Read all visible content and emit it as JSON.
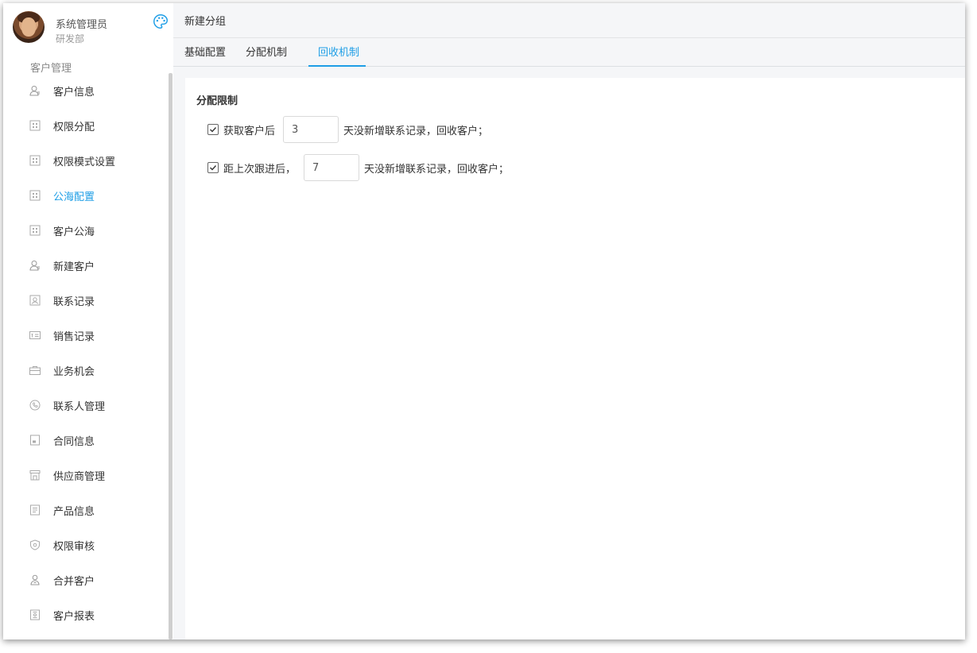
{
  "user": {
    "name": "系统管理员",
    "department": "研发部"
  },
  "sidebar": {
    "section_title": "客户管理",
    "active_color": "#1e9ee6",
    "items": [
      {
        "label": "客户信息",
        "icon": "user-icon"
      },
      {
        "label": "权限分配",
        "icon": "grid-icon"
      },
      {
        "label": "权限模式设置",
        "icon": "grid-icon"
      },
      {
        "label": "公海配置",
        "icon": "grid-icon",
        "active": true
      },
      {
        "label": "客户公海",
        "icon": "grid-icon"
      },
      {
        "label": "新建客户",
        "icon": "user-icon"
      },
      {
        "label": "联系记录",
        "icon": "record-icon"
      },
      {
        "label": "销售记录",
        "icon": "card-icon"
      },
      {
        "label": "业务机会",
        "icon": "briefcase-icon"
      },
      {
        "label": "联系人管理",
        "icon": "phone-icon"
      },
      {
        "label": "合同信息",
        "icon": "contract-icon"
      },
      {
        "label": "供应商管理",
        "icon": "store-icon"
      },
      {
        "label": "产品信息",
        "icon": "document-icon"
      },
      {
        "label": "权限审核",
        "icon": "shield-icon"
      },
      {
        "label": "合并客户",
        "icon": "merge-user-icon"
      },
      {
        "label": "客户报表",
        "icon": "report-icon"
      }
    ]
  },
  "header": {
    "title": "新建分组"
  },
  "tabs": [
    {
      "label": "基础配置"
    },
    {
      "label": "分配机制"
    },
    {
      "label": "回收机制",
      "active": true
    }
  ],
  "content": {
    "section_title": "分配限制",
    "rules": [
      {
        "checked": true,
        "label": "获取客户后",
        "value": "3",
        "suffix": "天没新增联系记录，回收客户；"
      },
      {
        "checked": true,
        "label": "距上次跟进后，",
        "value": "7",
        "suffix": "天没新增联系记录，回收客户；"
      }
    ]
  }
}
